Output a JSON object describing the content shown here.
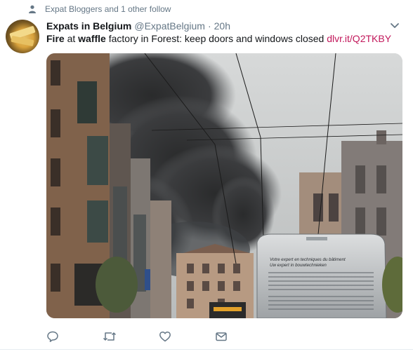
{
  "social_context": {
    "text": "Expat Bloggers and 1 other follow",
    "icon": "person-icon"
  },
  "author": {
    "name": "Expats in Belgium",
    "handle": "@ExpatBelgium",
    "separator": "·",
    "time": "20h"
  },
  "tweet": {
    "bold_1": "Fire",
    "text_1": " at ",
    "bold_2": "waffle",
    "text_2": " factory in Forest: keep doors and windows closed ",
    "link": "dlvr.it/Q2TKBY"
  },
  "media": {
    "truck_line_1": "Votre expert en techniques du bâtiment",
    "truck_line_2": "Uw expert in bouwtechnieken"
  },
  "actions": [
    {
      "name": "reply-button",
      "icon": "reply-icon"
    },
    {
      "name": "retweet-button",
      "icon": "retweet-icon"
    },
    {
      "name": "like-button",
      "icon": "heart-icon"
    },
    {
      "name": "message-button",
      "icon": "envelope-icon"
    }
  ],
  "colors": {
    "link": "#c2185b",
    "secondary_text": "#657786",
    "icon": "#657786"
  }
}
